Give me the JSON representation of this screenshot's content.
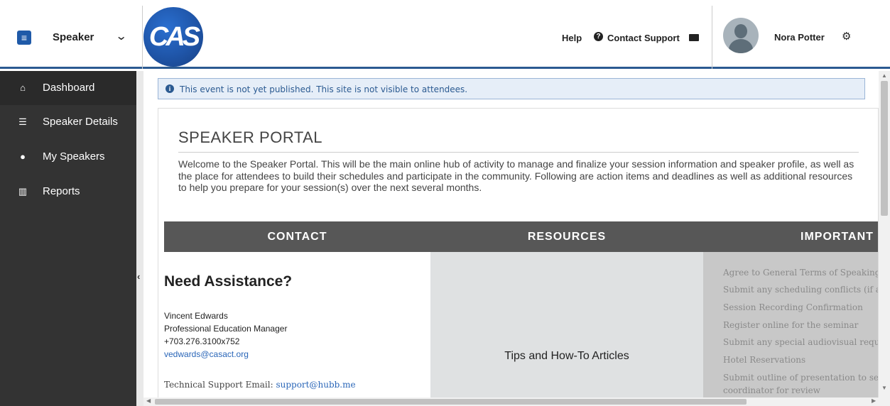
{
  "header": {
    "role": "Speaker",
    "logo_text": "CAS",
    "help": "Help",
    "contact_support": "Contact Support",
    "user_name": "Nora Potter"
  },
  "sidebar": {
    "items": [
      {
        "label": "Dashboard",
        "icon": "home-icon"
      },
      {
        "label": "Speaker Details",
        "icon": "list-icon"
      },
      {
        "label": "My Speakers",
        "icon": "users-icon"
      },
      {
        "label": "Reports",
        "icon": "bar-chart-icon"
      }
    ]
  },
  "notice": "This event is not yet published. This site is not visible to attendees.",
  "portal": {
    "title": "SPEAKER PORTAL",
    "intro": "Welcome to the Speaker Portal. This will be the main online hub of activity to manage and finalize your session information and speaker profile, as well as the place for attendees to build their schedules and participate in the community. Following are action items and deadlines as well as additional resources to help you prepare for your session(s) over the next several months."
  },
  "columns": {
    "contact": "CONTACT",
    "resources": "RESOURCES",
    "important": "IMPORTANT"
  },
  "contact": {
    "heading": "Need Assistance?",
    "name": "Vincent Edwards",
    "role": "Professional Education Manager",
    "phone": "+703.276.3100x752",
    "email": "vedwards@casact.org",
    "tech_label": "Technical Support Email: ",
    "tech_email": "support@hubb.me"
  },
  "resources": {
    "tips": "Tips and How-To Articles"
  },
  "important": {
    "items": [
      "Agree to General Terms of Speaking",
      "Submit any scheduling conflicts (if ap",
      "Session Recording Confirmation",
      "Register online for the seminar",
      "Submit any special audiovisual reque",
      " Hotel Reservations",
      "Submit outline of presentation to se",
      "coordinator for review"
    ]
  },
  "colors": {
    "brand_blue": "#2b5a91",
    "sidebar_bg": "#333333",
    "column_header_bg": "#575757"
  }
}
